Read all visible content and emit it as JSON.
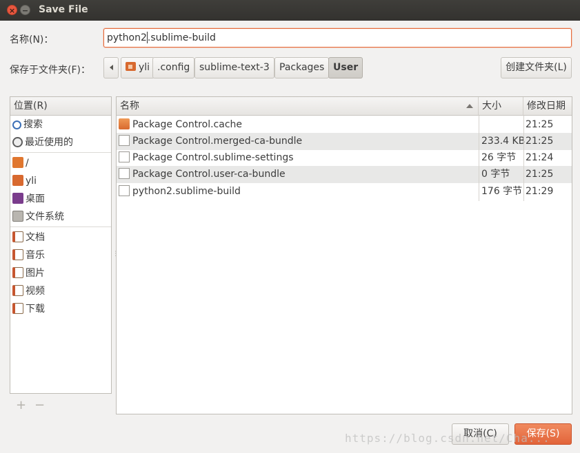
{
  "window": {
    "title": "Save File"
  },
  "name_field": {
    "label": "名称(N)：",
    "value_before_caret": "python2",
    "value_after_caret": ".sublime-build"
  },
  "folder": {
    "label": "保存于文件夹(F)：",
    "crumbs": [
      "yli",
      ".config",
      "sublime-text-3",
      "Packages",
      "User"
    ],
    "active_crumb": "User",
    "new_folder_label": "创建文件夹(L)"
  },
  "places": {
    "header": "位置(R)",
    "items": [
      {
        "label": "搜索",
        "icon": "search-icon"
      },
      {
        "label": "最近使用的",
        "icon": "recent-icon"
      },
      {
        "label": "/",
        "icon": "folder-icon"
      },
      {
        "label": "yli",
        "icon": "home-icon"
      },
      {
        "label": "桌面",
        "icon": "desktop-icon"
      },
      {
        "label": "文件系统",
        "icon": "filesystem-icon"
      },
      {
        "label": "文档",
        "icon": "documents-icon"
      },
      {
        "label": "音乐",
        "icon": "music-icon"
      },
      {
        "label": "图片",
        "icon": "pictures-icon"
      },
      {
        "label": "视频",
        "icon": "videos-icon"
      },
      {
        "label": "下载",
        "icon": "downloads-icon"
      }
    ],
    "add": "+",
    "remove": "−"
  },
  "files": {
    "columns": [
      "名称",
      "大小",
      "修改日期"
    ],
    "rows": [
      {
        "name": "Package Control.cache",
        "size": "",
        "date": "21:25",
        "type": "folder"
      },
      {
        "name": "Package Control.merged-ca-bundle",
        "size": "233.4 KB",
        "date": "21:25",
        "type": "file"
      },
      {
        "name": "Package Control.sublime-settings",
        "size": "26 字节",
        "date": "21:24",
        "type": "file"
      },
      {
        "name": "Package Control.user-ca-bundle",
        "size": "0 字节",
        "date": "21:25",
        "type": "file"
      },
      {
        "name": "python2.sublime-build",
        "size": "176 字节",
        "date": "21:29",
        "type": "file"
      }
    ]
  },
  "buttons": {
    "cancel": "取消(C)",
    "save": "保存(S)"
  },
  "watermark": "https://blog.csdn.net/Cha..."
}
